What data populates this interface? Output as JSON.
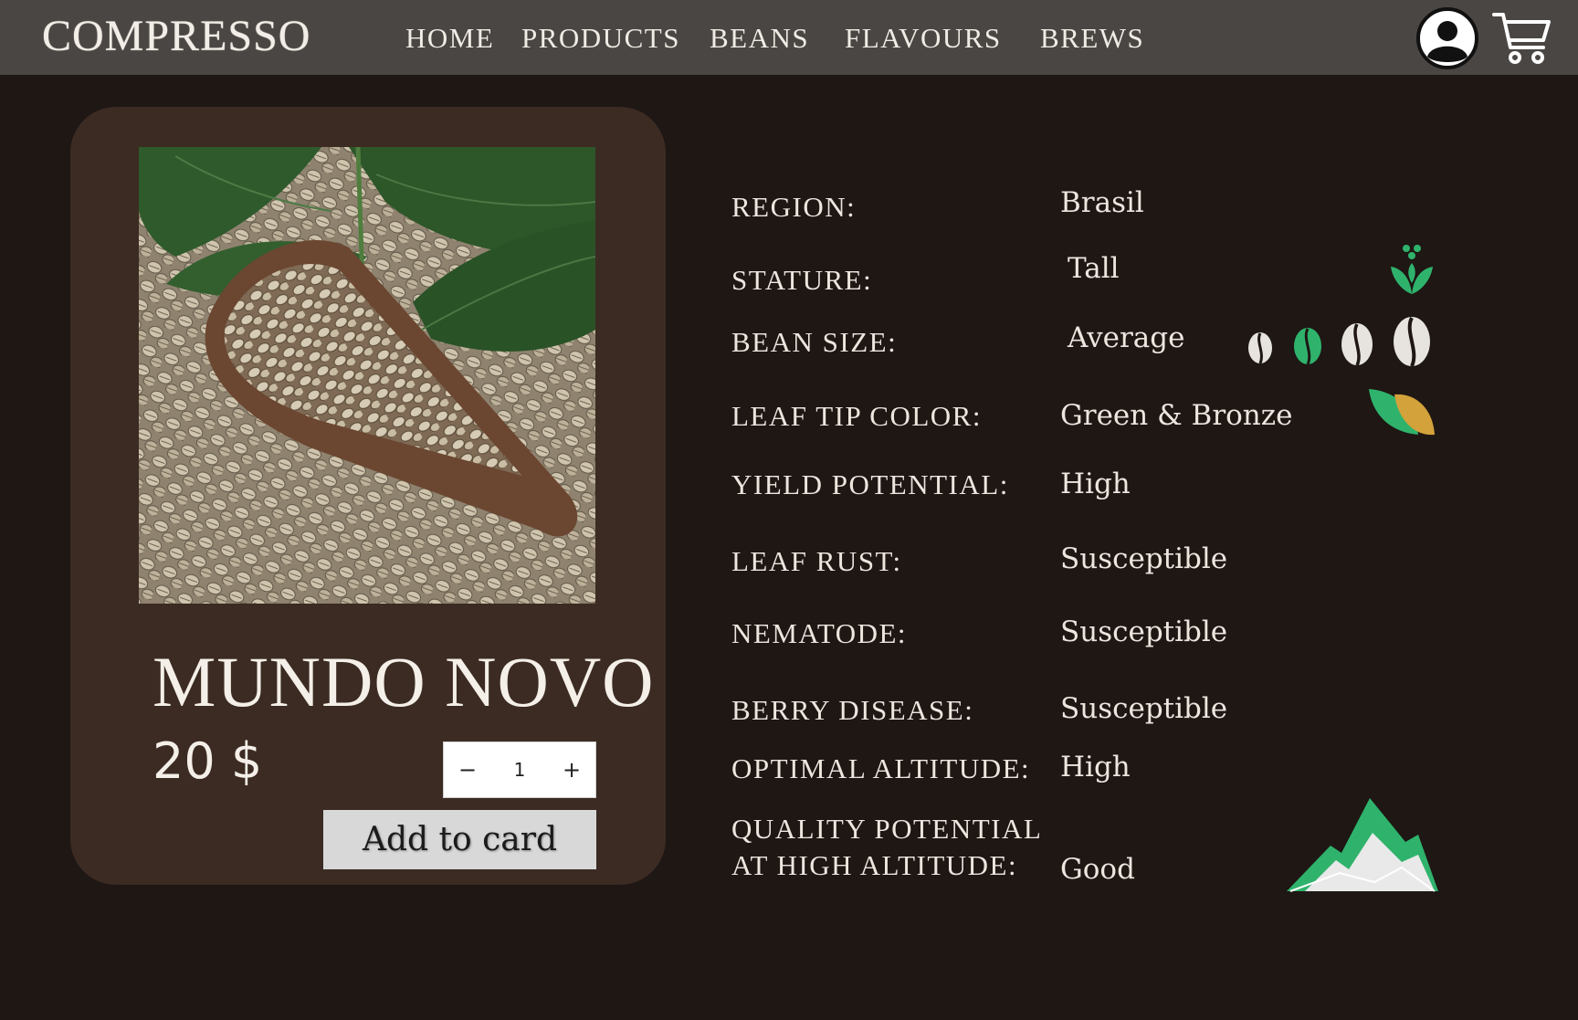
{
  "brand": {
    "logo": "COMPRESSO"
  },
  "nav": {
    "items": [
      {
        "label": "HOME"
      },
      {
        "label": "PRODUCTS"
      },
      {
        "label": "BEANS"
      },
      {
        "label": "FLAVOURS"
      },
      {
        "label": "BREWS"
      }
    ],
    "icons": [
      "user-account-icon",
      "shopping-cart-icon"
    ]
  },
  "product": {
    "name": "MUNDO NOVO",
    "price": "20 $",
    "quantity": "1",
    "decrement_label": "−",
    "increment_label": "+",
    "add_button_label": "Add to card",
    "image_alt": "green coffee beans in wooden scoop with coffee leaves"
  },
  "specs": [
    {
      "label": "REGION:",
      "value": "Brasil"
    },
    {
      "label": "STATURE:",
      "value": "Tall",
      "icon": "plant-sprout-icon"
    },
    {
      "label": "BEAN SIZE:",
      "value": "Average",
      "icon": "bean-size-scale-icon",
      "selected_size_index": 2
    },
    {
      "label": "LEAF TIP COLOR:",
      "value": "Green & Bronze",
      "icon": "green-bronze-leaf-icon"
    },
    {
      "label": "YIELD POTENTIAL:",
      "value": "High"
    },
    {
      "label": "LEAF RUST:",
      "value": "Susceptible"
    },
    {
      "label": "NEMATODE:",
      "value": "Susceptible"
    },
    {
      "label": "BERRY DISEASE:",
      "value": "Susceptible"
    },
    {
      "label": "OPTIMAL ALTITUDE:",
      "value": "High"
    },
    {
      "label_line1": "QUALITY POTENTIAL",
      "label_line2": "AT HIGH ALTITUDE:",
      "value": "Good",
      "icon": "mountain-icon"
    }
  ],
  "colors": {
    "page_bg": "#1e1714",
    "nav_bg": "#4a4643",
    "card_bg": "#3b2b22",
    "accent_green": "#2fb36c",
    "bronze": "#d4a23a"
  }
}
